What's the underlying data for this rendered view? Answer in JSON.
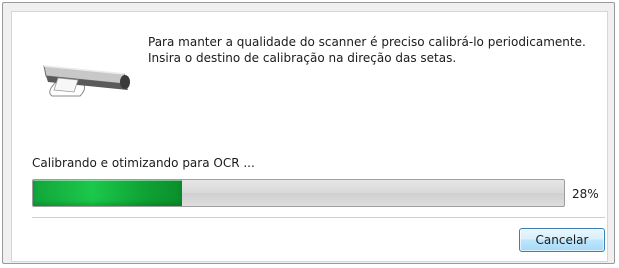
{
  "dialog": {
    "message_line1": "Para manter a qualidade do scanner é preciso calibrá-lo periodicamente.",
    "message_line2": "Insira o destino de calibração na direção das setas.",
    "icon": "scanner-calibration-icon"
  },
  "progress": {
    "status_text": "Calibrando e otimizando para OCR ...",
    "percent_value": 28,
    "percent_text": "28%",
    "fill_color": "#1bc84a"
  },
  "actions": {
    "cancel_label": "Cancelar"
  }
}
